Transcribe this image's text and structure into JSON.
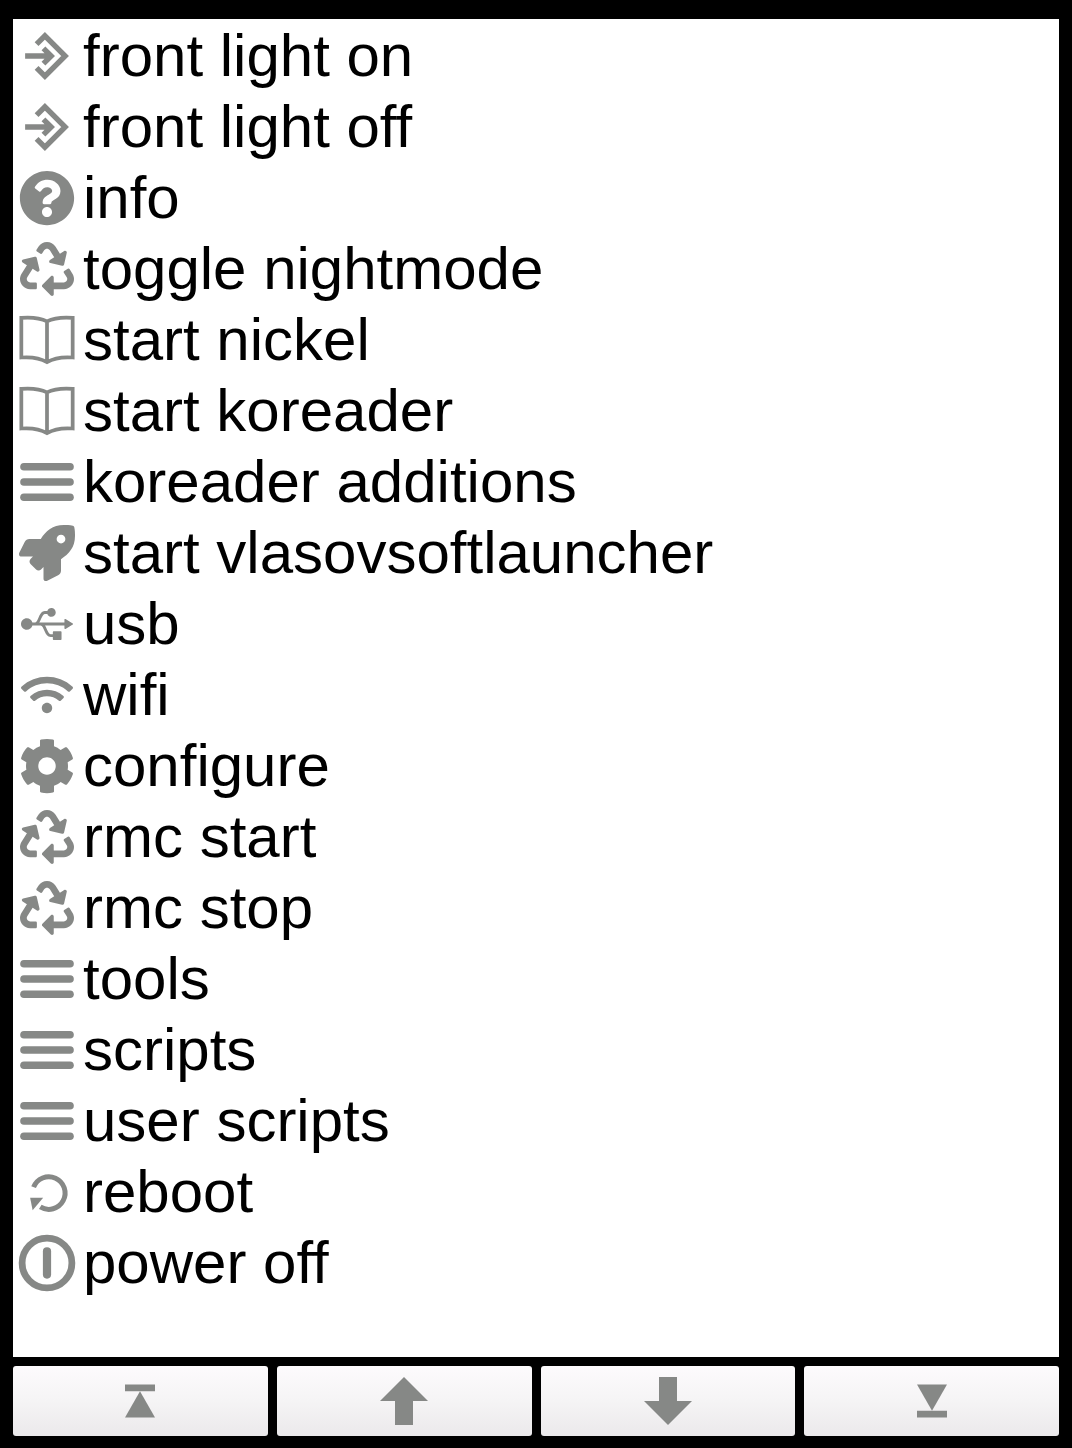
{
  "menu": {
    "items": [
      {
        "kind": "enter",
        "label": "front light on"
      },
      {
        "kind": "enter",
        "label": "front light off"
      },
      {
        "kind": "help",
        "label": "info"
      },
      {
        "kind": "recycle",
        "label": "toggle nightmode"
      },
      {
        "kind": "book",
        "label": "start nickel"
      },
      {
        "kind": "book",
        "label": "start koreader"
      },
      {
        "kind": "submenu",
        "label": "koreader additions"
      },
      {
        "kind": "rocket",
        "label": "start vlasovsoftlauncher"
      },
      {
        "kind": "usb",
        "label": "usb"
      },
      {
        "kind": "wifi",
        "label": "wifi"
      },
      {
        "kind": "gear",
        "label": "configure"
      },
      {
        "kind": "recycle",
        "label": "rmc start"
      },
      {
        "kind": "recycle",
        "label": "rmc stop"
      },
      {
        "kind": "submenu",
        "label": "tools"
      },
      {
        "kind": "submenu",
        "label": "scripts"
      },
      {
        "kind": "submenu",
        "label": "user scripts"
      },
      {
        "kind": "reboot",
        "label": "reboot"
      },
      {
        "kind": "power",
        "label": "power off"
      }
    ]
  },
  "nav_buttons": [
    {
      "kind": "first"
    },
    {
      "kind": "prev"
    },
    {
      "kind": "next"
    },
    {
      "kind": "last"
    }
  ]
}
